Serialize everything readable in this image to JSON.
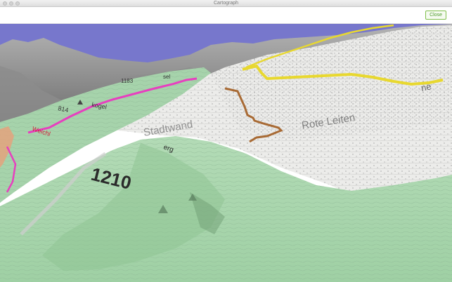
{
  "window": {
    "title": "Cartograph"
  },
  "toolbar": {
    "close_label": "Close"
  },
  "map": {
    "view": "3D terrain",
    "labels": {
      "elevation_1210": "1210",
      "elevation_814": "814",
      "elevation_1183": "1183",
      "place_weichl": "Weichl",
      "place_kogel": "kogel",
      "place_stadtwand": "Stadtwand",
      "place_rote": "Rote Leiten",
      "place_berg": "erg",
      "place_ne": "ne",
      "place_sel": "sel"
    },
    "colors": {
      "sky": "#7777cc",
      "forest": "#aed8b2",
      "open_terrain": "#ececea",
      "mountains": "#9a9a9a",
      "trail_magenta": "#e73fbf",
      "trail_yellow": "#e8d82f",
      "route_brown": "#a86a34"
    }
  }
}
